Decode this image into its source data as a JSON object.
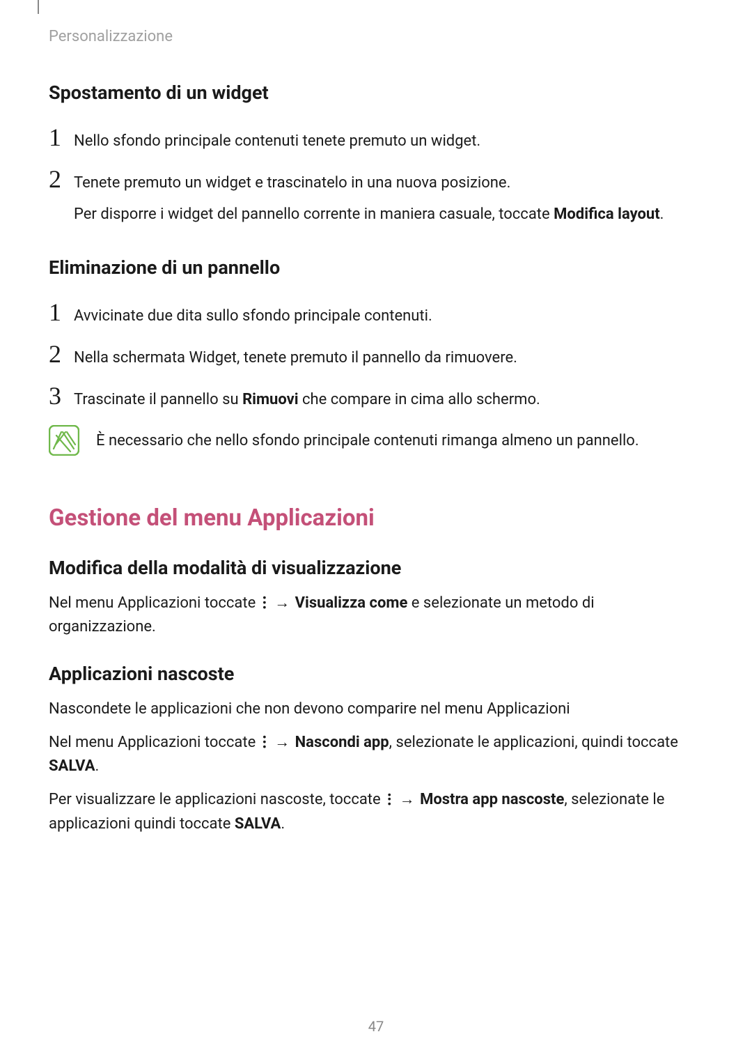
{
  "header": "Personalizzazione",
  "section1": {
    "title": "Spostamento di un widget",
    "step1": "Nello sfondo principale contenuti tenete premuto un widget.",
    "step2a": "Tenete premuto un widget e trascinatelo in una nuova posizione.",
    "step2b_pre": "Per disporre i widget del pannello corrente in maniera casuale, toccate ",
    "step2b_bold": "Modifica layout",
    "step2b_post": "."
  },
  "section2": {
    "title": "Eliminazione di un pannello",
    "step1": "Avvicinate due dita sullo sfondo principale contenuti.",
    "step2": "Nella schermata Widget, tenete premuto il pannello da rimuovere.",
    "step3_pre": "Trascinate il pannello su ",
    "step3_bold": "Rimuovi",
    "step3_post": " che compare in cima allo schermo.",
    "note": "È necessario che nello sfondo principale contenuti rimanga almeno un pannello."
  },
  "majorTitle": "Gestione del menu Applicazioni",
  "section3": {
    "title": "Modifica della modalità di visualizzazione",
    "p1_pre": "Nel menu Applicazioni toccate ",
    "p1_arrow": "→",
    "p1_bold": "Visualizza come",
    "p1_post": " e selezionate un metodo di organizzazione."
  },
  "section4": {
    "title": "Applicazioni nascoste",
    "p1": "Nascondete le applicazioni che non devono comparire nel menu Applicazioni",
    "p2_pre": "Nel menu Applicazioni toccate ",
    "p2_arrow": "→",
    "p2_bold1": "Nascondi app",
    "p2_mid": ", selezionate le applicazioni, quindi toccate ",
    "p2_bold2": "SALVA",
    "p2_post": ".",
    "p3_pre": "Per visualizzare le applicazioni nascoste, toccate ",
    "p3_arrow": "→",
    "p3_bold1": "Mostra app nascoste",
    "p3_mid": ", selezionate le applicazioni quindi toccate ",
    "p3_bold2": "SALVA",
    "p3_post": "."
  },
  "pageNumber": "47",
  "nums": {
    "n1": "1",
    "n2": "2",
    "n3": "3"
  }
}
